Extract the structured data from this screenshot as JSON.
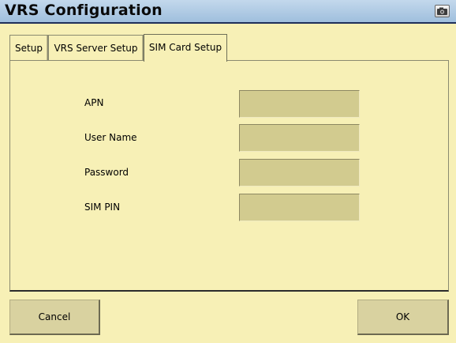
{
  "window": {
    "title": "VRS Configuration",
    "camera_icon": "camera-icon"
  },
  "tabs": [
    {
      "label": "Setup",
      "active": false
    },
    {
      "label": "VRS Server Setup",
      "active": false
    },
    {
      "label": "SIM Card Setup",
      "active": true
    }
  ],
  "form": {
    "apn": {
      "label": "APN",
      "value": ""
    },
    "user_name": {
      "label": "User Name",
      "value": ""
    },
    "password": {
      "label": "Password",
      "value": ""
    },
    "sim_pin": {
      "label": "SIM PIN",
      "value": ""
    }
  },
  "buttons": {
    "cancel": "Cancel",
    "ok": "OK"
  },
  "colors": {
    "background": "#f7f0b6",
    "input_fill": "#d2cb8f",
    "button_fill": "#d9d2a0",
    "titlebar": "#a9c6e3"
  }
}
